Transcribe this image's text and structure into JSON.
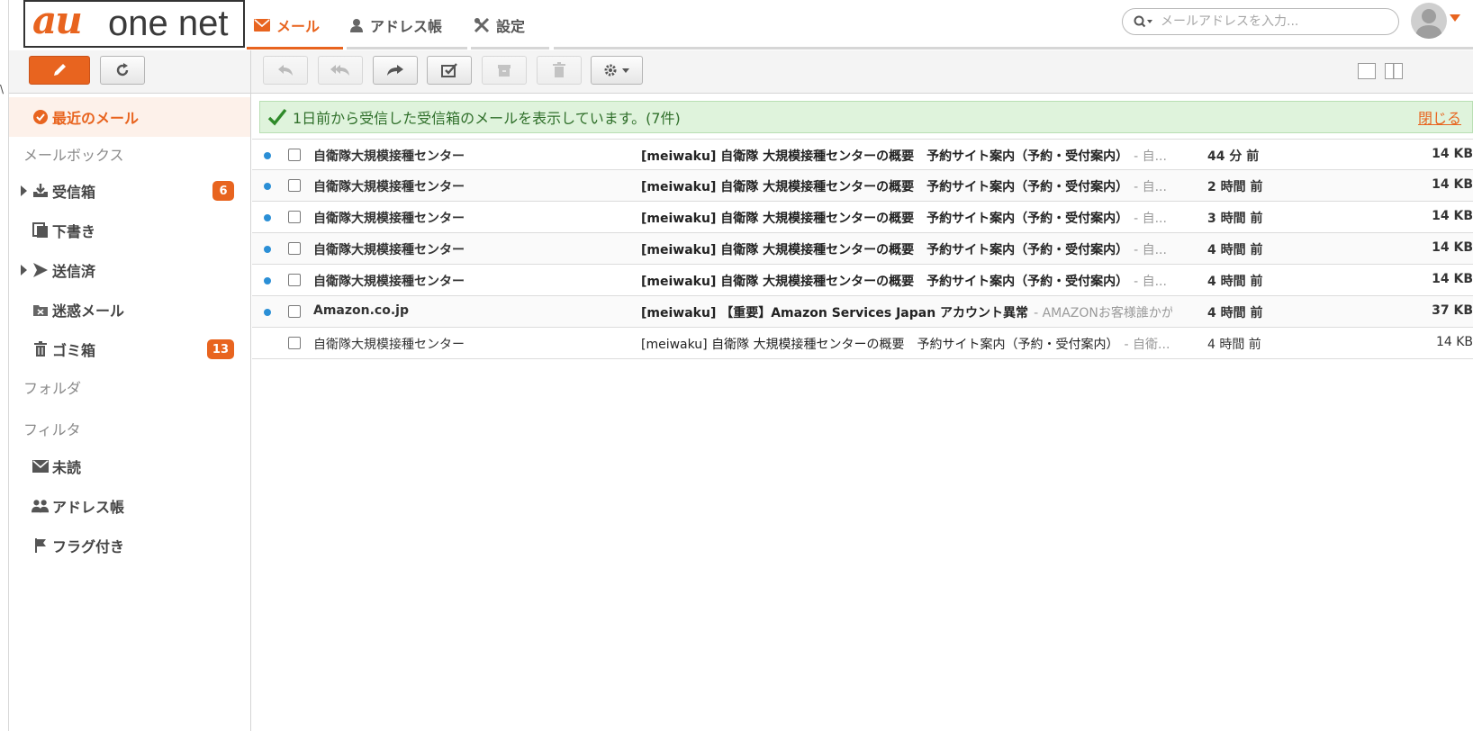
{
  "app": {
    "logo_prefix": "au",
    "logo_suffix": "one net"
  },
  "nav": {
    "mail": "メール",
    "address_book": "アドレス帳",
    "settings": "設定"
  },
  "search": {
    "placeholder": "メールアドレスを入力..."
  },
  "colors": {
    "accent": "#e8641f",
    "unread_dot": "#2b8fd6",
    "notice_bg": "#dff3dc"
  },
  "toolbar": {
    "icons": [
      "pencil-icon",
      "refresh-icon",
      "reply-icon",
      "reply-all-icon",
      "forward-icon",
      "mark-read-icon",
      "archive-icon",
      "trash-icon",
      "gear-icon"
    ]
  },
  "sidebar": {
    "recent": "最近のメール",
    "mailbox_heading": "メールボックス",
    "inbox": "受信箱",
    "inbox_count": "6",
    "drafts": "下書き",
    "sent": "送信済",
    "spam": "迷惑メール",
    "trash": "ゴミ箱",
    "trash_count": "13",
    "folder_heading": "フォルダ",
    "filter_heading": "フィルタ",
    "unread": "未読",
    "address_book": "アドレス帳",
    "flagged": "フラグ付き"
  },
  "notice": {
    "message": "1日前から受信した受信箱のメールを表示しています。(7件)",
    "close": "閉じる"
  },
  "messages": [
    {
      "from": "自衛隊大規模接種センター",
      "subject": "[meiwaku] 自衛隊 大規模接種センターの概要　予約サイト案内（予約・受付案内）",
      "snippet": "- 自...",
      "time": "44 分 前",
      "size": "14 KB",
      "unread": true
    },
    {
      "from": "自衛隊大規模接種センター",
      "subject": "[meiwaku] 自衛隊 大規模接種センターの概要　予約サイト案内（予約・受付案内）",
      "snippet": "- 自...",
      "time": "2 時間 前",
      "size": "14 KB",
      "unread": true
    },
    {
      "from": "自衛隊大規模接種センター",
      "subject": "[meiwaku] 自衛隊 大規模接種センターの概要　予約サイト案内（予約・受付案内）",
      "snippet": "- 自...",
      "time": "3 時間 前",
      "size": "14 KB",
      "unread": true
    },
    {
      "from": "自衛隊大規模接種センター",
      "subject": "[meiwaku] 自衛隊 大規模接種センターの概要　予約サイト案内（予約・受付案内）",
      "snippet": "- 自...",
      "time": "4 時間 前",
      "size": "14 KB",
      "unread": true
    },
    {
      "from": "自衛隊大規模接種センター",
      "subject": "[meiwaku] 自衛隊 大規模接種センターの概要　予約サイト案内（予約・受付案内）",
      "snippet": "- 自...",
      "time": "4 時間 前",
      "size": "14 KB",
      "unread": true
    },
    {
      "from": "Amazon.co.jp",
      "subject": "[meiwaku] 【重要】Amazon Services Japan アカウント異常",
      "snippet": "- AMAZONお客様誰かがあ...",
      "time": "4 時間 前",
      "size": "37 KB",
      "unread": true
    },
    {
      "from": "自衛隊大規模接種センター",
      "subject": "[meiwaku] 自衛隊 大規模接種センターの概要　予約サイト案内（予約・受付案内）",
      "snippet": "- 自衛...",
      "time": "4 時間 前",
      "size": "14 KB",
      "unread": false
    }
  ]
}
